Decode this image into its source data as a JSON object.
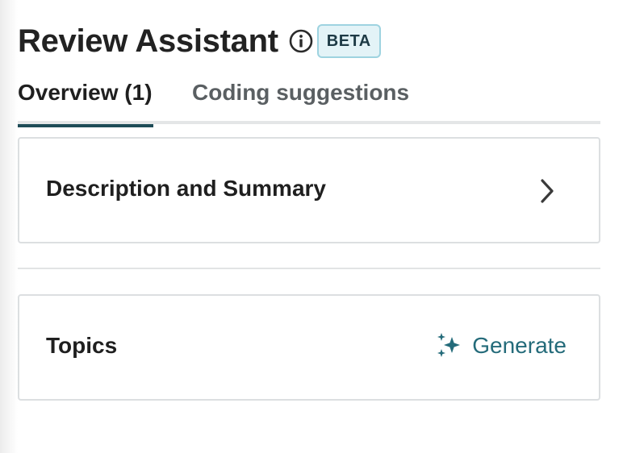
{
  "header": {
    "title": "Review Assistant",
    "info_icon": "info-circle-icon",
    "badge": "BETA"
  },
  "tabs": [
    {
      "label": "Overview (1)",
      "active": true
    },
    {
      "label": "Coding suggestions",
      "active": false
    }
  ],
  "cards": {
    "description": {
      "label": "Description and Summary",
      "icon": "chevron-right-icon"
    },
    "topics": {
      "label": "Topics",
      "action_label": "Generate",
      "action_icon": "sparkle-icon"
    }
  },
  "colors": {
    "accent": "#246b7a",
    "tab_indicator": "#1e4c57",
    "badge_bg": "#e3f3f7",
    "badge_border": "#9ed3e0"
  }
}
